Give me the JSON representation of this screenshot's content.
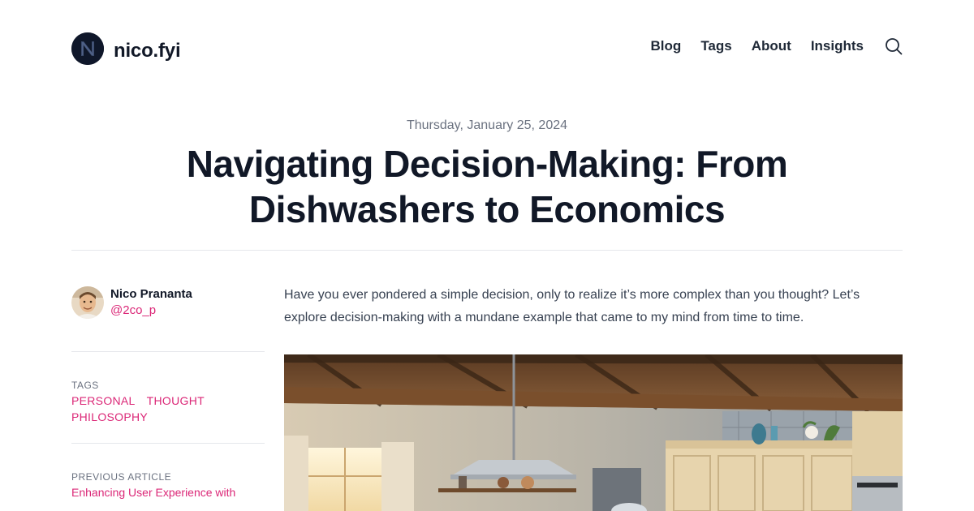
{
  "header": {
    "site_name": "nico.fyi",
    "logo_icon": "n-letter-logo-icon",
    "nav": [
      {
        "label": "Blog"
      },
      {
        "label": "Tags"
      },
      {
        "label": "About"
      },
      {
        "label": "Insights"
      }
    ],
    "search_icon": "search-icon"
  },
  "article": {
    "date": "Thursday, January 25, 2024",
    "title": "Navigating Decision-Making: From Dishwashers to Economics",
    "intro": "Have you ever pondered a simple decision, only to realize it’s more complex than you thought? Let’s explore decision-making with a mundane example that came to my mind from time to time.",
    "hero_image": "kitchen-illustration"
  },
  "sidebar": {
    "author_name": "Nico Prananta",
    "author_handle": "@2co_p",
    "tags_label": "Tags",
    "tags": [
      "Personal",
      "Thought",
      "Philosophy"
    ],
    "prev_label": "Previous Article",
    "prev_title": "Enhancing User Experience with"
  },
  "colors": {
    "accent": "#db2777",
    "text": "#111827",
    "muted": "#6b7280",
    "divider": "#e5e7eb"
  }
}
